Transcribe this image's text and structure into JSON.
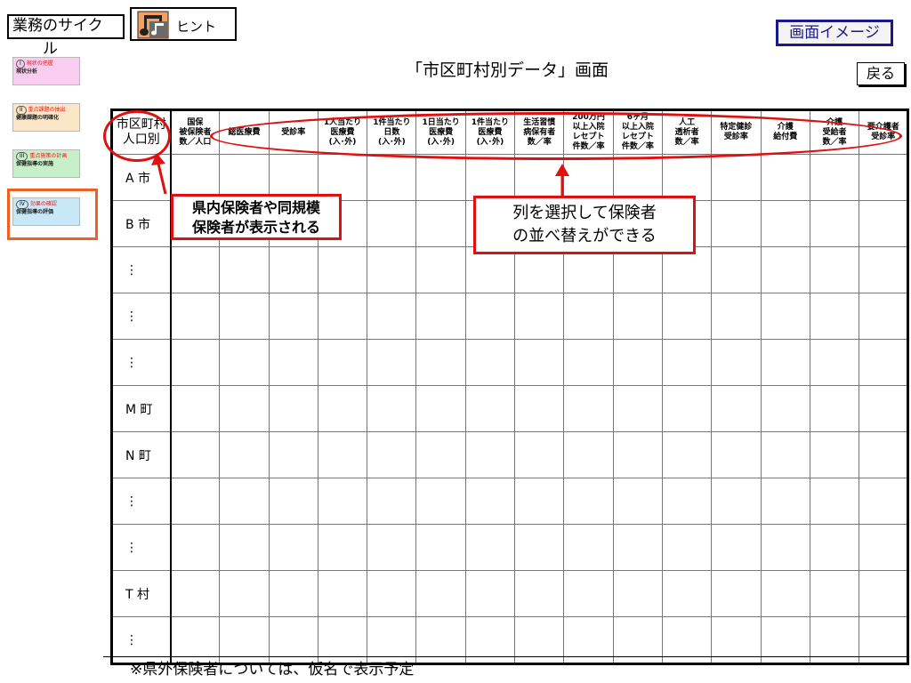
{
  "header": {
    "cycle_label": "業務のサイク",
    "cycle_label_wrap": "ル",
    "hint_label": "ヒント",
    "image_label": "画面イメージ",
    "title": "「市区町村別データ」画面",
    "back_label": "戻る"
  },
  "sidebar": {
    "items": [
      {
        "num": "I",
        "sub": "現状の把握",
        "main": "現状分析",
        "bg": "#f8cdf0"
      },
      {
        "num": "II",
        "sub": "重点課題の抽出",
        "main": "健康課題の明確化",
        "bg": "#fbe7c8"
      },
      {
        "num": "III",
        "sub": "重点施策の計画",
        "main": "保健指導の実施",
        "bg": "#c8f0c8"
      },
      {
        "num": "IV",
        "sub": "効果の確認",
        "main": "保健指導の評価",
        "bg": "#c8e8f8"
      }
    ]
  },
  "table": {
    "headers": [
      "市区町村\n人口別",
      "国保\n被保険者\n数／人口",
      "総医療費",
      "受診率",
      "1人当たり\n医療費\n(入･外)",
      "1件当たり\n日数\n(入･外)",
      "1日当たり\n医療費\n(入･外)",
      "1件当たり\n医療費\n(入･外)",
      "生活習慣\n病保有者\n数／率",
      "200万円\n以上入院\nレセプト\n件数／率",
      "6ヶ月\n以上入院\nレセプト\n件数／率",
      "人工\n透析者\n数／率",
      "特定健診\n受診率",
      "介護\n給付費",
      "介護\n受給者\n数／率",
      "要介護者\n受診率"
    ],
    "rows": [
      "A 市",
      "B 市",
      "⋮",
      "⋮",
      "⋮",
      "M 町",
      "N 町",
      "⋮",
      "⋮",
      "T 村",
      "⋮"
    ]
  },
  "annotations": {
    "left_callout": "県内保険者や同規模\n保険者が表示される",
    "right_callout": "列を選択して保険者\nの並べ替えができる"
  },
  "footnote": "※県外保険者については、仮名で表示予定",
  "colors": {
    "accent": "#e01010",
    "selected": "#f06020",
    "image_label": "#1a1a8a"
  }
}
